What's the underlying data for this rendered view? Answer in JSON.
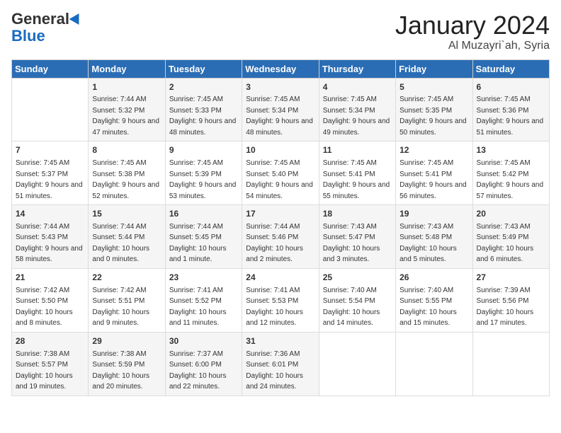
{
  "logo": {
    "general": "General",
    "blue": "Blue"
  },
  "header": {
    "month": "January 2024",
    "location": "Al Muzayri`ah, Syria"
  },
  "days_of_week": [
    "Sunday",
    "Monday",
    "Tuesday",
    "Wednesday",
    "Thursday",
    "Friday",
    "Saturday"
  ],
  "weeks": [
    [
      {
        "day": "",
        "sunrise": "",
        "sunset": "",
        "daylight": ""
      },
      {
        "day": "1",
        "sunrise": "Sunrise: 7:44 AM",
        "sunset": "Sunset: 5:32 PM",
        "daylight": "Daylight: 9 hours and 47 minutes."
      },
      {
        "day": "2",
        "sunrise": "Sunrise: 7:45 AM",
        "sunset": "Sunset: 5:33 PM",
        "daylight": "Daylight: 9 hours and 48 minutes."
      },
      {
        "day": "3",
        "sunrise": "Sunrise: 7:45 AM",
        "sunset": "Sunset: 5:34 PM",
        "daylight": "Daylight: 9 hours and 48 minutes."
      },
      {
        "day": "4",
        "sunrise": "Sunrise: 7:45 AM",
        "sunset": "Sunset: 5:34 PM",
        "daylight": "Daylight: 9 hours and 49 minutes."
      },
      {
        "day": "5",
        "sunrise": "Sunrise: 7:45 AM",
        "sunset": "Sunset: 5:35 PM",
        "daylight": "Daylight: 9 hours and 50 minutes."
      },
      {
        "day": "6",
        "sunrise": "Sunrise: 7:45 AM",
        "sunset": "Sunset: 5:36 PM",
        "daylight": "Daylight: 9 hours and 51 minutes."
      }
    ],
    [
      {
        "day": "7",
        "sunrise": "Sunrise: 7:45 AM",
        "sunset": "Sunset: 5:37 PM",
        "daylight": "Daylight: 9 hours and 51 minutes."
      },
      {
        "day": "8",
        "sunrise": "Sunrise: 7:45 AM",
        "sunset": "Sunset: 5:38 PM",
        "daylight": "Daylight: 9 hours and 52 minutes."
      },
      {
        "day": "9",
        "sunrise": "Sunrise: 7:45 AM",
        "sunset": "Sunset: 5:39 PM",
        "daylight": "Daylight: 9 hours and 53 minutes."
      },
      {
        "day": "10",
        "sunrise": "Sunrise: 7:45 AM",
        "sunset": "Sunset: 5:40 PM",
        "daylight": "Daylight: 9 hours and 54 minutes."
      },
      {
        "day": "11",
        "sunrise": "Sunrise: 7:45 AM",
        "sunset": "Sunset: 5:41 PM",
        "daylight": "Daylight: 9 hours and 55 minutes."
      },
      {
        "day": "12",
        "sunrise": "Sunrise: 7:45 AM",
        "sunset": "Sunset: 5:41 PM",
        "daylight": "Daylight: 9 hours and 56 minutes."
      },
      {
        "day": "13",
        "sunrise": "Sunrise: 7:45 AM",
        "sunset": "Sunset: 5:42 PM",
        "daylight": "Daylight: 9 hours and 57 minutes."
      }
    ],
    [
      {
        "day": "14",
        "sunrise": "Sunrise: 7:44 AM",
        "sunset": "Sunset: 5:43 PM",
        "daylight": "Daylight: 9 hours and 58 minutes."
      },
      {
        "day": "15",
        "sunrise": "Sunrise: 7:44 AM",
        "sunset": "Sunset: 5:44 PM",
        "daylight": "Daylight: 10 hours and 0 minutes."
      },
      {
        "day": "16",
        "sunrise": "Sunrise: 7:44 AM",
        "sunset": "Sunset: 5:45 PM",
        "daylight": "Daylight: 10 hours and 1 minute."
      },
      {
        "day": "17",
        "sunrise": "Sunrise: 7:44 AM",
        "sunset": "Sunset: 5:46 PM",
        "daylight": "Daylight: 10 hours and 2 minutes."
      },
      {
        "day": "18",
        "sunrise": "Sunrise: 7:43 AM",
        "sunset": "Sunset: 5:47 PM",
        "daylight": "Daylight: 10 hours and 3 minutes."
      },
      {
        "day": "19",
        "sunrise": "Sunrise: 7:43 AM",
        "sunset": "Sunset: 5:48 PM",
        "daylight": "Daylight: 10 hours and 5 minutes."
      },
      {
        "day": "20",
        "sunrise": "Sunrise: 7:43 AM",
        "sunset": "Sunset: 5:49 PM",
        "daylight": "Daylight: 10 hours and 6 minutes."
      }
    ],
    [
      {
        "day": "21",
        "sunrise": "Sunrise: 7:42 AM",
        "sunset": "Sunset: 5:50 PM",
        "daylight": "Daylight: 10 hours and 8 minutes."
      },
      {
        "day": "22",
        "sunrise": "Sunrise: 7:42 AM",
        "sunset": "Sunset: 5:51 PM",
        "daylight": "Daylight: 10 hours and 9 minutes."
      },
      {
        "day": "23",
        "sunrise": "Sunrise: 7:41 AM",
        "sunset": "Sunset: 5:52 PM",
        "daylight": "Daylight: 10 hours and 11 minutes."
      },
      {
        "day": "24",
        "sunrise": "Sunrise: 7:41 AM",
        "sunset": "Sunset: 5:53 PM",
        "daylight": "Daylight: 10 hours and 12 minutes."
      },
      {
        "day": "25",
        "sunrise": "Sunrise: 7:40 AM",
        "sunset": "Sunset: 5:54 PM",
        "daylight": "Daylight: 10 hours and 14 minutes."
      },
      {
        "day": "26",
        "sunrise": "Sunrise: 7:40 AM",
        "sunset": "Sunset: 5:55 PM",
        "daylight": "Daylight: 10 hours and 15 minutes."
      },
      {
        "day": "27",
        "sunrise": "Sunrise: 7:39 AM",
        "sunset": "Sunset: 5:56 PM",
        "daylight": "Daylight: 10 hours and 17 minutes."
      }
    ],
    [
      {
        "day": "28",
        "sunrise": "Sunrise: 7:38 AM",
        "sunset": "Sunset: 5:57 PM",
        "daylight": "Daylight: 10 hours and 19 minutes."
      },
      {
        "day": "29",
        "sunrise": "Sunrise: 7:38 AM",
        "sunset": "Sunset: 5:59 PM",
        "daylight": "Daylight: 10 hours and 20 minutes."
      },
      {
        "day": "30",
        "sunrise": "Sunrise: 7:37 AM",
        "sunset": "Sunset: 6:00 PM",
        "daylight": "Daylight: 10 hours and 22 minutes."
      },
      {
        "day": "31",
        "sunrise": "Sunrise: 7:36 AM",
        "sunset": "Sunset: 6:01 PM",
        "daylight": "Daylight: 10 hours and 24 minutes."
      },
      {
        "day": "",
        "sunrise": "",
        "sunset": "",
        "daylight": ""
      },
      {
        "day": "",
        "sunrise": "",
        "sunset": "",
        "daylight": ""
      },
      {
        "day": "",
        "sunrise": "",
        "sunset": "",
        "daylight": ""
      }
    ]
  ]
}
